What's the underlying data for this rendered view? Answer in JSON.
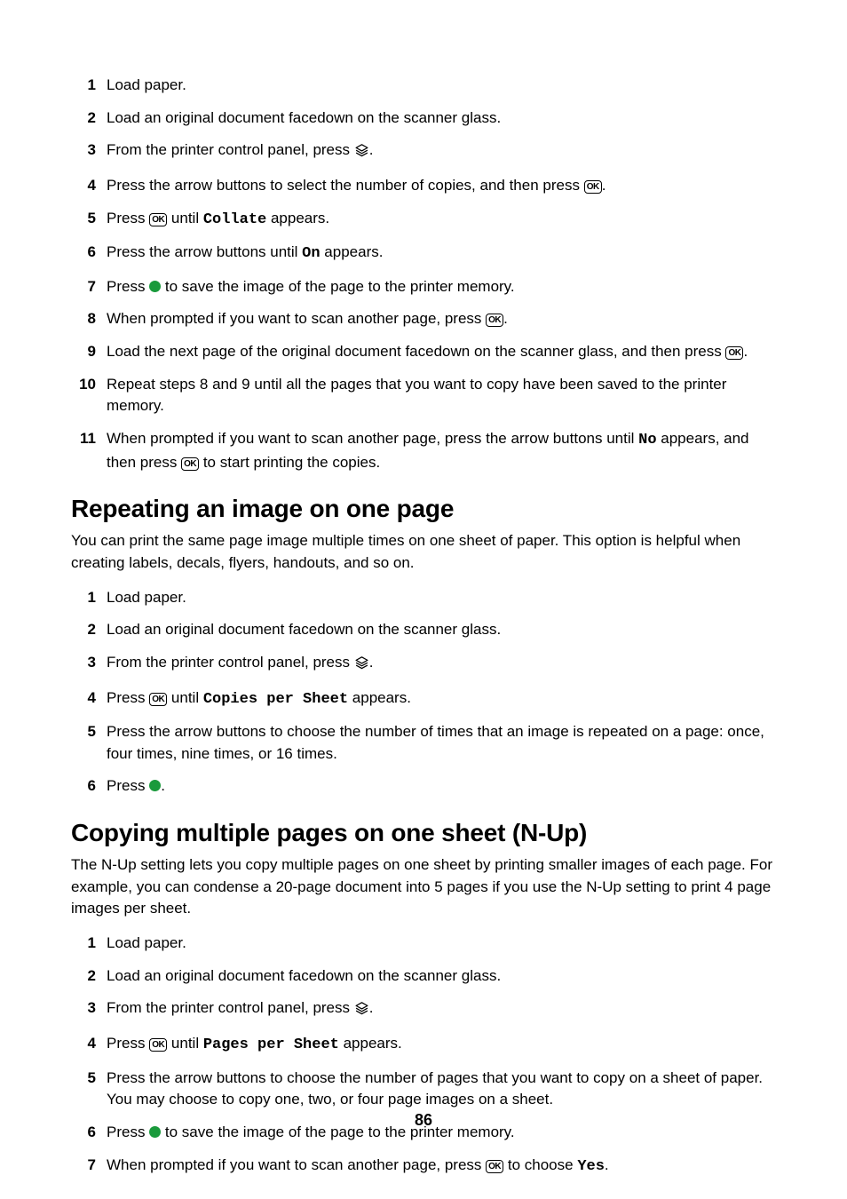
{
  "icons": {
    "ok_key_label": "OK"
  },
  "section_a_steps": [
    {
      "pre": "Load paper."
    },
    {
      "pre": "Load an original document facedown on the scanner glass."
    },
    {
      "pre": "From the printer control panel, press ",
      "icon": "copy",
      "post": "."
    },
    {
      "pre": "Press the arrow buttons to select the number of copies, and then press ",
      "icon": "ok",
      "post": "."
    },
    {
      "pre": "Press ",
      "icon": "ok",
      "mid": " until ",
      "mono": "Collate",
      "post": " appears."
    },
    {
      "pre": "Press the arrow buttons until ",
      "mono": "On",
      "post": " appears."
    },
    {
      "pre": "Press ",
      "icon": "green",
      "post": " to save the image of the page to the printer memory."
    },
    {
      "pre": "When prompted if you want to scan another page, press ",
      "icon": "ok",
      "post": "."
    },
    {
      "pre": "Load the next page of the original document facedown on the scanner glass, and then press ",
      "icon": "ok",
      "post": "."
    },
    {
      "pre": "Repeat steps 8 and 9 until all the pages that you want to copy have been saved to the printer memory."
    },
    {
      "pre": "When prompted if you want to scan another page, press the arrow buttons until ",
      "mono": "No",
      "post_mono_pre_icon": " appears, and then press ",
      "icon": "ok",
      "post": " to start printing the copies."
    }
  ],
  "section_b": {
    "heading": "Repeating an image on one page",
    "para": "You can print the same page image multiple times on one sheet of paper. This option is helpful when creating labels, decals, flyers, handouts, and so on.",
    "steps": [
      {
        "pre": "Load paper."
      },
      {
        "pre": "Load an original document facedown on the scanner glass."
      },
      {
        "pre": "From the printer control panel, press ",
        "icon": "copy",
        "post": "."
      },
      {
        "pre": "Press ",
        "icon": "ok",
        "mid": " until ",
        "mono": "Copies per Sheet",
        "post": " appears."
      },
      {
        "pre": "Press the arrow buttons to choose the number of times that an image is repeated on a page: once, four times, nine times, or 16 times."
      },
      {
        "pre": "Press ",
        "icon": "green",
        "post": "."
      }
    ]
  },
  "section_c": {
    "heading": "Copying multiple pages on one sheet (N-Up)",
    "para": "The N-Up setting lets you copy multiple pages on one sheet by printing smaller images of each page. For example, you can condense a 20-page document into 5 pages if you use the N-Up setting to print 4 page images per sheet.",
    "steps": [
      {
        "pre": "Load paper."
      },
      {
        "pre": "Load an original document facedown on the scanner glass."
      },
      {
        "pre": "From the printer control panel, press ",
        "icon": "copy",
        "post": "."
      },
      {
        "pre": "Press ",
        "icon": "ok",
        "mid": " until ",
        "mono": "Pages per Sheet",
        "post": " appears."
      },
      {
        "pre": "Press the arrow buttons to choose the number of pages that you want to copy on a sheet of paper. You may choose to copy one, two, or four page images on a sheet."
      },
      {
        "pre": "Press ",
        "icon": "green",
        "post": " to save the image of the page to the printer memory."
      },
      {
        "pre": "When prompted if you want to scan another page, press ",
        "icon": "ok",
        "mid": " to choose ",
        "mono": "Yes",
        "post": "."
      }
    ]
  },
  "page_number": "86"
}
